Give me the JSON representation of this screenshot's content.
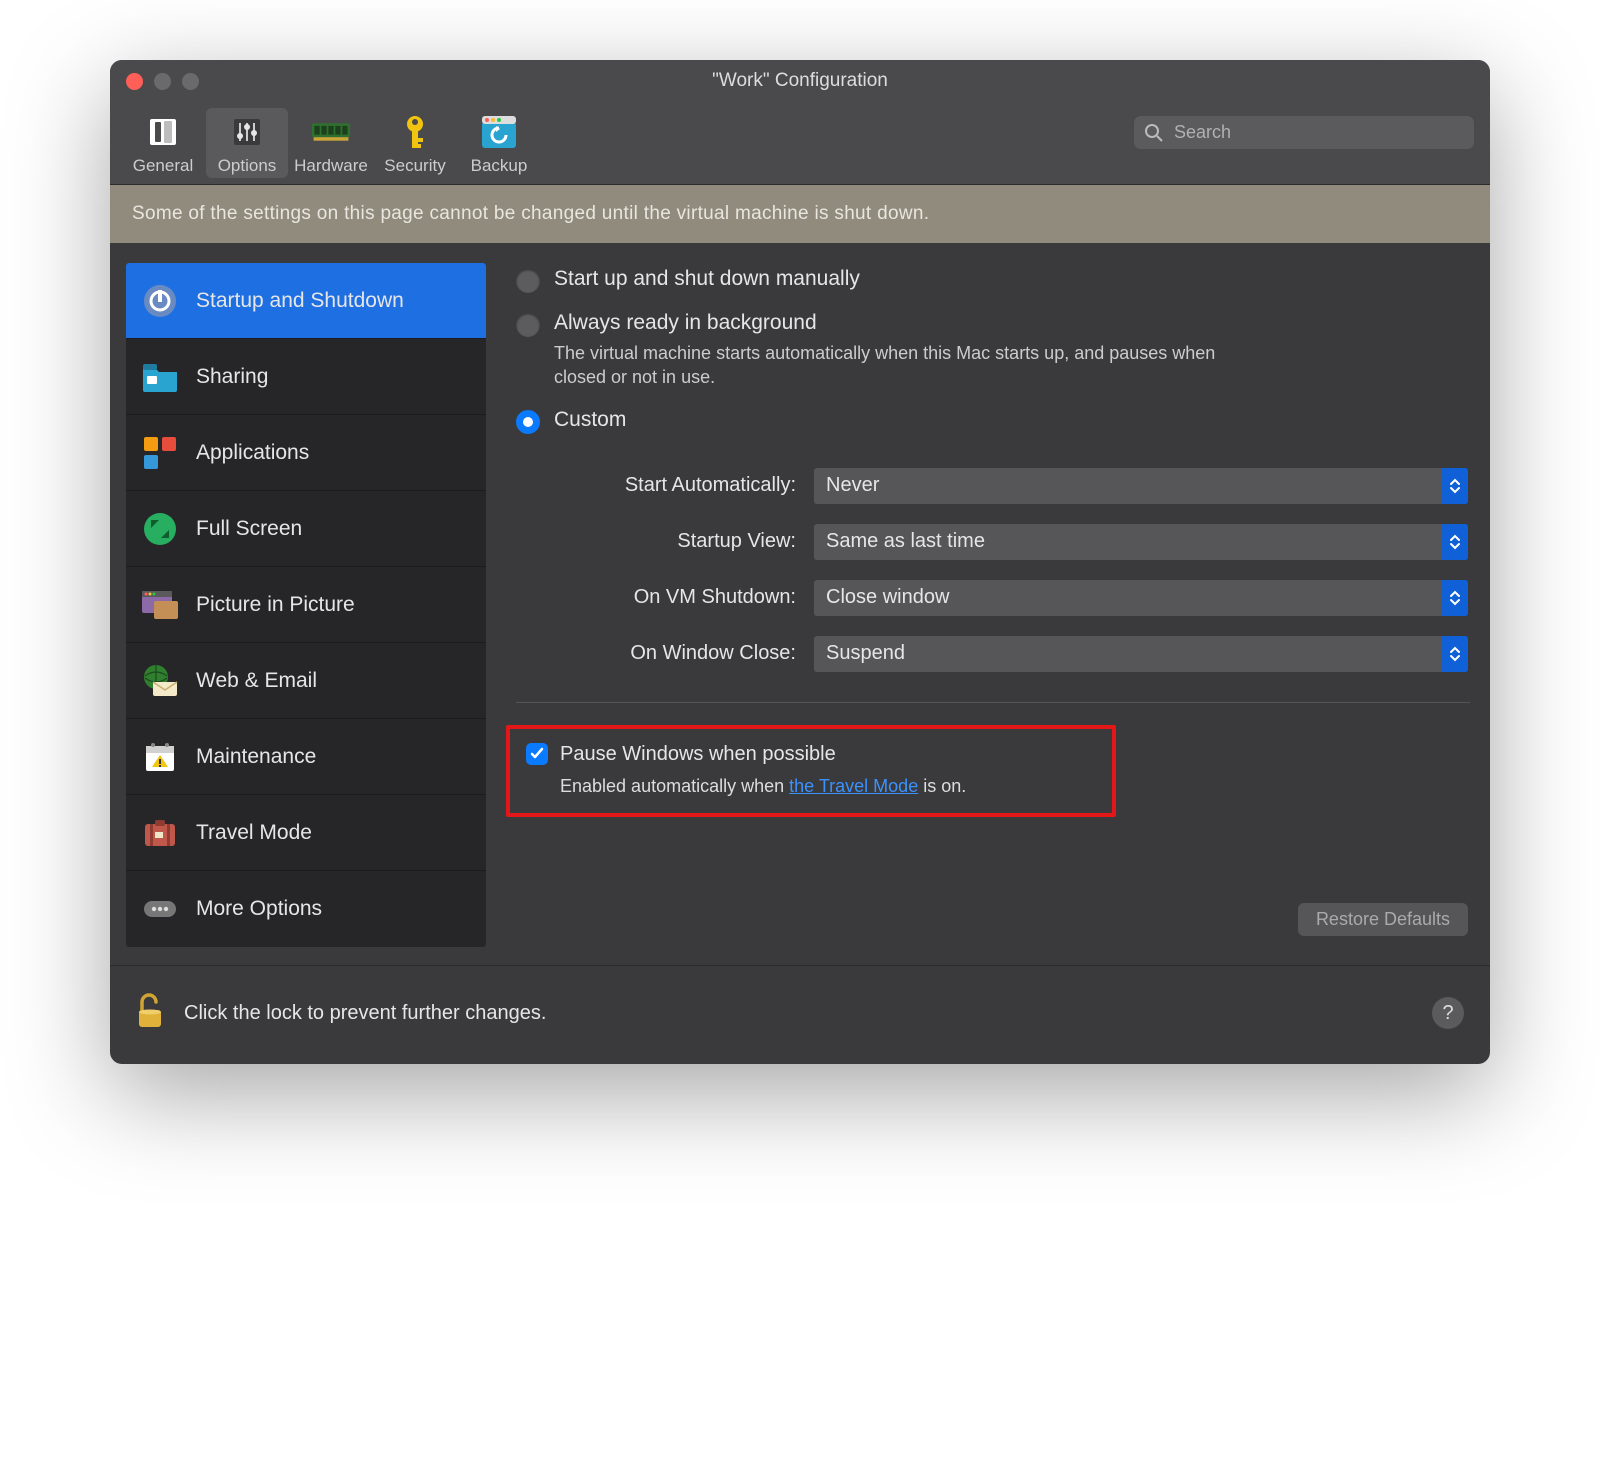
{
  "window": {
    "title": "\"Work\" Configuration"
  },
  "toolbar": {
    "tabs": [
      {
        "label": "General"
      },
      {
        "label": "Options"
      },
      {
        "label": "Hardware"
      },
      {
        "label": "Security"
      },
      {
        "label": "Backup"
      }
    ],
    "search_placeholder": "Search"
  },
  "banner": {
    "text": "Some of the settings on this page cannot be changed until the virtual machine is shut down."
  },
  "sidebar": {
    "items": [
      {
        "label": "Startup and Shutdown"
      },
      {
        "label": "Sharing"
      },
      {
        "label": "Applications"
      },
      {
        "label": "Full Screen"
      },
      {
        "label": "Picture in Picture"
      },
      {
        "label": "Web & Email"
      },
      {
        "label": "Maintenance"
      },
      {
        "label": "Travel Mode"
      },
      {
        "label": "More Options"
      }
    ]
  },
  "main": {
    "radios": [
      {
        "label": "Start up and shut down manually"
      },
      {
        "label": "Always ready in background",
        "desc": "The virtual machine starts automatically when this Mac starts up, and pauses when closed or not in use."
      },
      {
        "label": "Custom"
      }
    ],
    "form": [
      {
        "label": "Start Automatically:",
        "value": "Never"
      },
      {
        "label": "Startup View:",
        "value": "Same as last time"
      },
      {
        "label": "On VM Shutdown:",
        "value": "Close window"
      },
      {
        "label": "On Window Close:",
        "value": "Suspend"
      }
    ],
    "pause": {
      "label": "Pause Windows when possible",
      "desc_pre": "Enabled automatically when ",
      "link": "the Travel Mode",
      "desc_post": " is on."
    },
    "restore_label": "Restore Defaults"
  },
  "footer": {
    "lock_text": "Click the lock to prevent further changes.",
    "help_glyph": "?"
  }
}
